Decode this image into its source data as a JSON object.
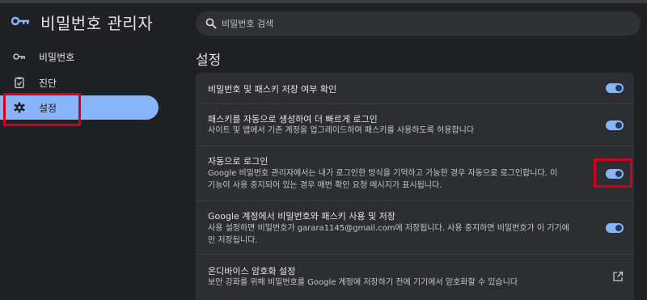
{
  "header": {
    "title": "비밀번호 관리자",
    "search_placeholder": "비밀번호 검색"
  },
  "sidebar": {
    "items": [
      {
        "label": "비밀번호",
        "icon": "key-icon",
        "active": false
      },
      {
        "label": "진단",
        "icon": "clipboard-check-icon",
        "active": false
      },
      {
        "label": "설정",
        "icon": "gear-icon",
        "active": true
      }
    ]
  },
  "main": {
    "section_title": "설정",
    "settings": [
      {
        "title": "비밀번호 및 패스키 저장 여부 확인",
        "control": "toggle",
        "on": true
      },
      {
        "title": "패스키를 자동으로 생성하여 더 빠르게 로그인",
        "description": "사이트 및 앱에서 기존 계정을 업그레이드하여 패스키를 사용하도록 허용합니다",
        "control": "toggle",
        "on": true
      },
      {
        "title": "자동으로 로그인",
        "description_line1": "Google 비밀번호 관리자에서는 내가 로그인한 방식을 기억하고 가능한 경우 자동으로 로그인합니다. 이",
        "description_line2": "기능이 사용 중지되어 있는 경우 매번 확인 요청 메시지가 표시됩니다.",
        "control": "toggle",
        "on": true,
        "highlighted": true
      },
      {
        "title": "Google 계정에서 비밀번호와 패스키 사용 및 저장",
        "description_line1": "사용 설정하면 비밀번호가 garara1145@gmail.com에 저장됩니다. 사용 중지하면 비밀번호가 이 기기에",
        "description_line2": "만 저장됩니다.",
        "control": "toggle",
        "on": true
      },
      {
        "title": "온디바이스 암호화 설정",
        "description": "보안 강화를 위해 비밀번호를 Google 계정에 저장하기 전에 기기에서 암호화할 수 있습니다",
        "control": "external-link",
        "icon": "open-in-new-icon"
      }
    ]
  },
  "colors": {
    "background": "#202124",
    "accent": "#8ab4f8",
    "card": "#2d2e31",
    "highlight": "#d0021b"
  }
}
